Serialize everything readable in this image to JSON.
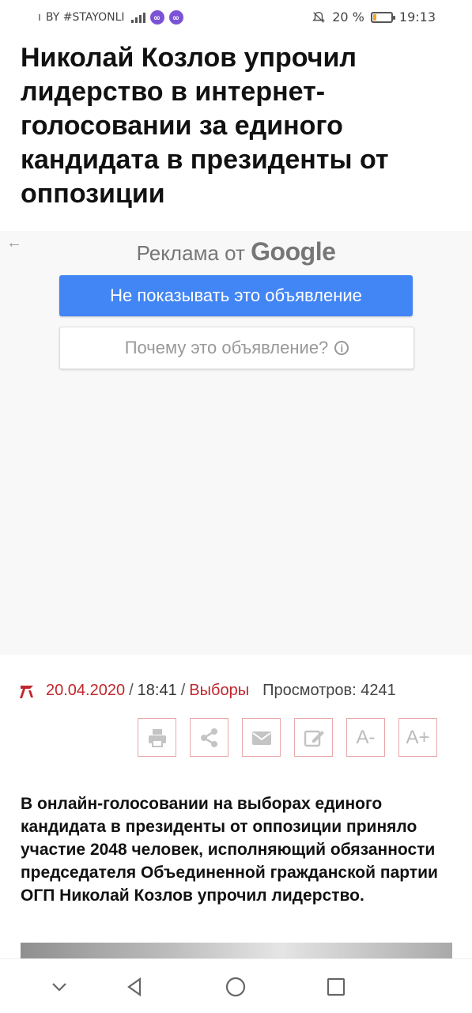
{
  "status_bar": {
    "carrier": "BY #STAYONLI",
    "battery": "20 %",
    "battery_level": 0.2,
    "time": "19:13",
    "icons": [
      "signal-icon",
      "app-icon",
      "app-icon",
      "mute-icon",
      "battery-icon"
    ]
  },
  "article": {
    "headline": "Николай Козлов упрочил лидерство в интернет-голосовании за единого кандидата в президенты от оппозиции",
    "date": "20.04.2020",
    "time": "18:41",
    "category": "Выборы",
    "views": "Просмотров: 4241",
    "lead": "В онлайн-голосовании на выборах единого кандидата в президенты от оппозиции приняло участие 2048 человек, исполняющий обязанности председателя Объединенной гражданской партии ОГП Николай Козлов упрочил лидерство."
  },
  "ad": {
    "label": "Реклама от",
    "brand": "Google",
    "hide_button": "Не показывать это объявление",
    "why_button": "Почему это объявление?"
  },
  "tools": {
    "font_smaller": "A-",
    "font_larger": "A+"
  },
  "colors": {
    "accent_red": "#c0272d",
    "google_blue": "#4285f4"
  }
}
